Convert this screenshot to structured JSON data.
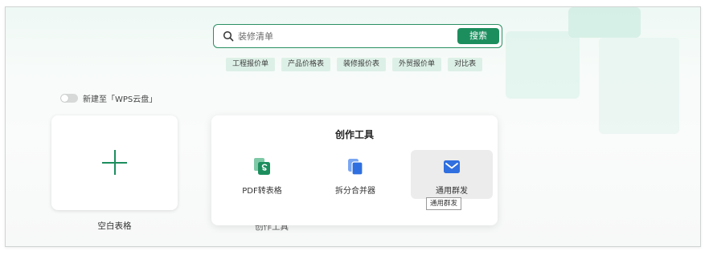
{
  "search": {
    "placeholder": "装修清单",
    "button_label": "搜索"
  },
  "tags": [
    "工程报价单",
    "产品价格表",
    "装修报价表",
    "外贸报价单",
    "对比表"
  ],
  "cloud_toggle": {
    "label": "新建至「WPS云盘」",
    "on": false
  },
  "blank_card": {
    "label": "空白表格"
  },
  "obscured_label": "创作工具",
  "tools_panel": {
    "title": "创作工具",
    "tools": [
      {
        "label": "PDF转表格",
        "icon": "pdf-to-sheet-icon"
      },
      {
        "label": "拆分合并器",
        "icon": "split-merge-icon"
      },
      {
        "label": "通用群发",
        "icon": "mail-icon"
      }
    ],
    "tooltip": "通用群发"
  },
  "colors": {
    "brand_green": "#1c8e5e",
    "tag_bg": "#ddf0e7",
    "mail_blue": "#2f6fe0"
  }
}
